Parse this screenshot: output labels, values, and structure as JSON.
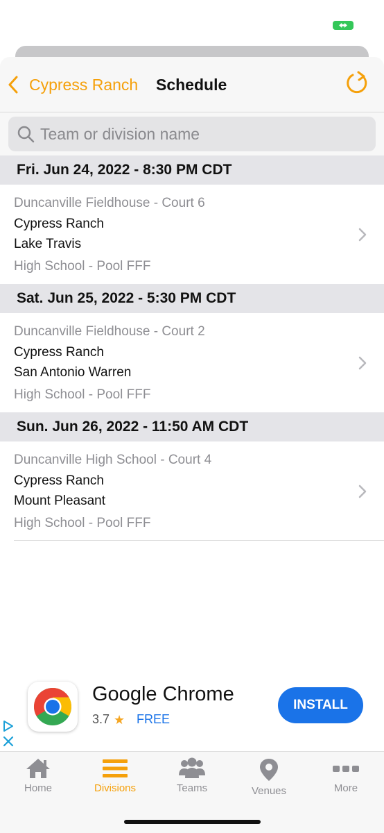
{
  "colors": {
    "accent": "#f5a00a",
    "install_blue": "#1a73e8",
    "battery_green": "#34c759"
  },
  "nav": {
    "back_label": "Cypress Ranch",
    "title": "Schedule"
  },
  "search": {
    "placeholder": "Team or division name"
  },
  "schedule": [
    {
      "date_header": "Fri. Jun 24, 2022 - 8:30 PM CDT",
      "venue": "Duncanville Fieldhouse - Court 6",
      "team1": "Cypress Ranch",
      "team2": "Lake Travis",
      "division": "High School - Pool FFF"
    },
    {
      "date_header": "Sat. Jun 25, 2022 - 5:30 PM CDT",
      "venue": "Duncanville Fieldhouse - Court 2",
      "team1": "Cypress Ranch",
      "team2": "San Antonio Warren",
      "division": "High School - Pool FFF"
    },
    {
      "date_header": "Sun. Jun 26, 2022 - 11:50 AM CDT",
      "venue": "Duncanville High School - Court 4",
      "team1": "Cypress Ranch",
      "team2": "Mount Pleasant",
      "division": "High School - Pool FFF"
    }
  ],
  "ad": {
    "app_name": "Google Chrome",
    "rating": "3.7",
    "price": "FREE",
    "install_label": "INSTALL"
  },
  "tabs": [
    {
      "label": "Home",
      "icon": "home-icon",
      "active": false
    },
    {
      "label": "Divisions",
      "icon": "list-icon",
      "active": true
    },
    {
      "label": "Teams",
      "icon": "people-icon",
      "active": false
    },
    {
      "label": "Venues",
      "icon": "map-pin-icon",
      "active": false
    },
    {
      "label": "More",
      "icon": "ellipsis-icon",
      "active": false
    }
  ]
}
